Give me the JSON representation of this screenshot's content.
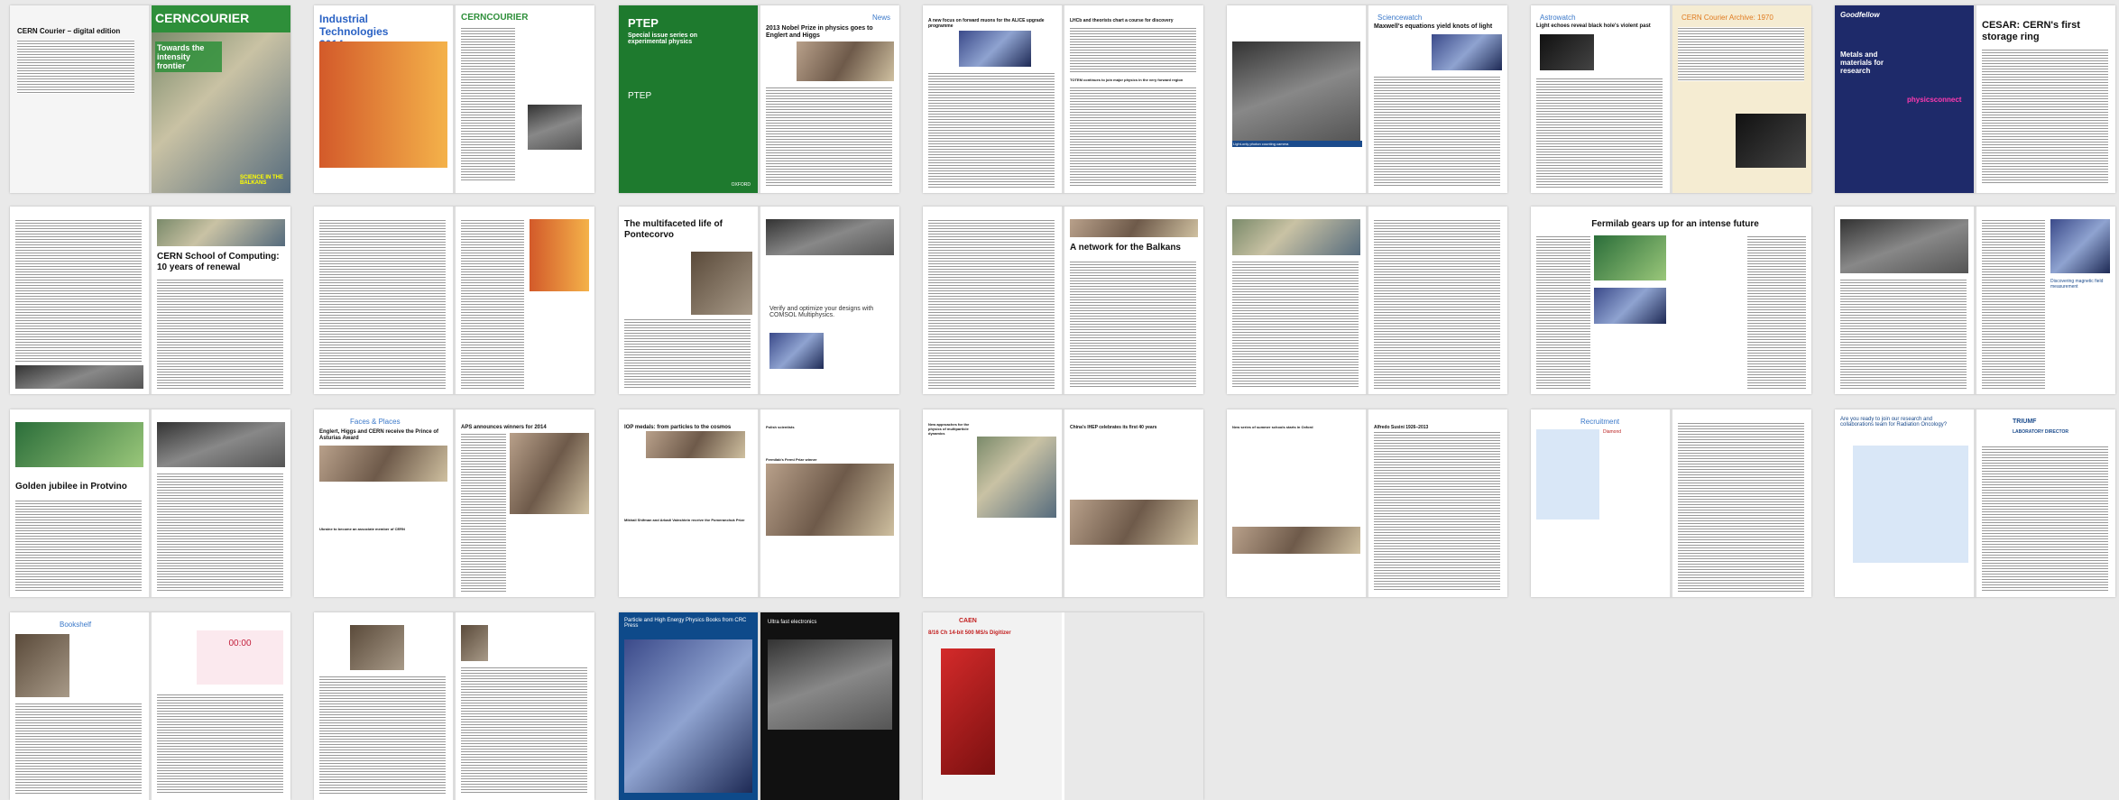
{
  "colors": {
    "courier_green": "#2e8f3a",
    "ptep_green": "#1e7a2e",
    "section_blue": "#3a78c9",
    "archive_orange": "#e07a1e",
    "triumf_blue": "#1b4b8c"
  },
  "spreads": [
    {
      "left": "CERN Courier – digital edition",
      "right_title": "CERNCOURIER",
      "right_sub": "Towards the intensity frontier",
      "right_tag": "SCIENCE IN THE BALKANS"
    },
    {
      "left": "Industrial Technologies 2014",
      "right": "CERNCOURIER"
    },
    {
      "left_title": "PTEP",
      "left_sub": "Special issue series on experimental physics",
      "left_logo": "PTEP",
      "left_pub": "OXFORD",
      "section": "News",
      "right": "2013 Nobel Prize in physics goes to Englert and Higgs"
    },
    {
      "left": "A new focus on forward muons for the ALICE upgrade programme",
      "right": "LHCb and theorists chart a course for discovery",
      "right_sub": "TOTEM continues to join major physics in the very forward region"
    },
    {
      "section": "Sciencewatch",
      "right": "Maxwell's equations yield knots of light",
      "left_caption": "Light-only photon counting camera"
    },
    {
      "section": "Astrowatch",
      "left": "Light echoes reveal black hole's violent past",
      "archive": "CERN Courier Archive: 1970"
    },
    {
      "left_logo": "Goodfellow",
      "left_sub": "Metals and materials for research",
      "left_ad": "physicsconnect",
      "right": "CESAR: CERN's first storage ring"
    },
    {
      "right": "CERN School of Computing: 10 years of renewal"
    },
    {
      "right": ""
    },
    {
      "left": "The multifaceted life of Pontecorvo",
      "right_ad": "Verify and optimize your designs with COMSOL Multiphysics."
    },
    {
      "right": "A network for the Balkans"
    },
    {
      "right": ""
    },
    {
      "left": "Fermilab gears up for an intense future"
    },
    {
      "right_ad": "Discovering magnetic field measurement"
    },
    {
      "left": "Golden jubilee in Protvino"
    },
    {
      "section": "Faces & Places",
      "left": "Englert, Higgs and CERN receive the Prince of Asturias Award",
      "left_sub": "Ukraine to become an associate member of CERN",
      "right": "APS announces winners for 2014"
    },
    {
      "left": "IOP medals: from particles to the cosmos",
      "left_sub": "Mikhail Shifman and Arkadi Vainshtein receive the Pomeranchuk Prize",
      "right": "Polish scientists",
      "right_sub": "Fermilab's Fermi Prize winner"
    },
    {
      "left": "New approaches for the physics of multiparticle dynamics",
      "right": "China's IHEP celebrates its first 40 years"
    },
    {
      "left": "New series of summer schools starts in Oxford",
      "right": "Alfredo Susini 1926–2013"
    },
    {
      "section": "Recruitment",
      "left_ad": "Diamond"
    },
    {
      "left": "Are you ready to join our research and collaborations team for Radiation Oncology?",
      "right_logo": "TRIUMF",
      "right_sub": "LABORATORY DIRECTOR"
    },
    {
      "section": "Bookshelf",
      "right": "00:00"
    },
    {
      "right": ""
    },
    {
      "left": "Particle and High Energy Physics Books from CRC Press",
      "right_sub": "Ultra fast electronics"
    },
    {
      "left_logo": "CAEN",
      "left": "8/16 Ch 14-bit 500 MS/s Digitizer"
    }
  ]
}
